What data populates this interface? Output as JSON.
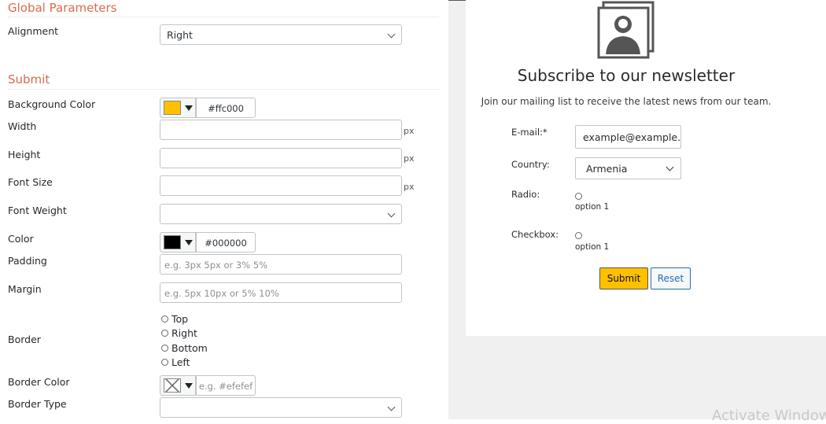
{
  "sections": {
    "global_title": "Global Parameters",
    "submit_title": "Submit"
  },
  "global": {
    "alignment_label": "Alignment",
    "alignment_value": "Right"
  },
  "submit": {
    "bg_color_label": "Background Color",
    "bg_color_value": "#ffc000",
    "bg_swatch": "#ffc000",
    "width_label": "Width",
    "height_label": "Height",
    "font_size_label": "Font Size",
    "font_weight_label": "Font Weight",
    "color_label": "Color",
    "color_value": "#000000",
    "color_swatch": "#000000",
    "padding_label": "Padding",
    "padding_placeholder": "e.g. 3px 5px or 3% 5%",
    "margin_label": "Margin",
    "margin_placeholder": "e.g. 5px 10px or 5% 10%",
    "border_label": "Border",
    "border_options": [
      "Top",
      "Right",
      "Bottom",
      "Left"
    ],
    "border_color_label": "Border Color",
    "border_color_placeholder": "e.g. #efefef",
    "border_type_label": "Border Type",
    "unit": "px"
  },
  "preview": {
    "title": "Subscribe to our newsletter",
    "description": "Join our mailing list to receive the latest news from our team.",
    "email_label": "E-mail:*",
    "email_value": "example@example.",
    "country_label": "Country:",
    "country_value": "Armenia",
    "radio_label": "Radio:",
    "radio_option": "option 1",
    "checkbox_label": "Checkbox:",
    "checkbox_option": "option 1",
    "submit_label": "Submit",
    "reset_label": "Reset",
    "submit_color": "#ffc000"
  },
  "watermark": "Activate Windows"
}
